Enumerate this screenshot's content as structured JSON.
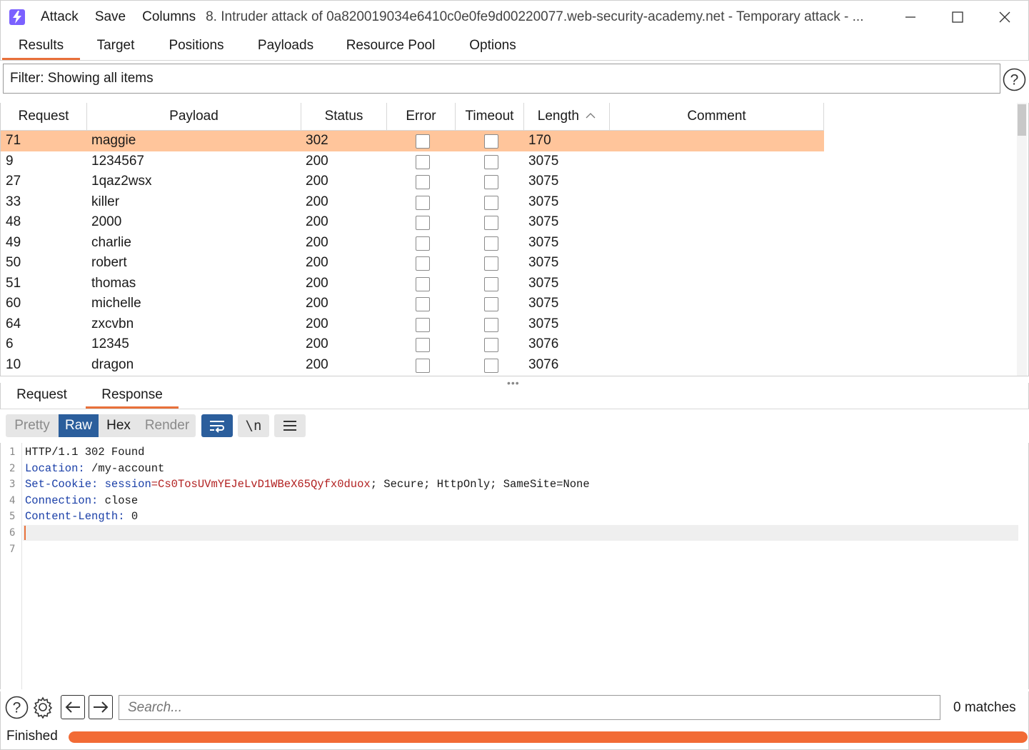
{
  "titlebar": {
    "menus": [
      "Attack",
      "Save",
      "Columns"
    ],
    "title": "8. Intruder attack of 0a820019034e6410c0e0fe9d00220077.web-security-academy.net - Temporary attack - ..."
  },
  "tabs": [
    {
      "label": "Results",
      "active": true
    },
    {
      "label": "Target",
      "active": false
    },
    {
      "label": "Positions",
      "active": false
    },
    {
      "label": "Payloads",
      "active": false
    },
    {
      "label": "Resource Pool",
      "active": false
    },
    {
      "label": "Options",
      "active": false
    }
  ],
  "filter": {
    "text": "Filter: Showing all items"
  },
  "table": {
    "columns": [
      "Request",
      "Payload",
      "Status",
      "Error",
      "Timeout",
      "Length",
      "Comment"
    ],
    "sort_indicator": "^",
    "rows": [
      {
        "request": "71",
        "payload": "maggie",
        "status": "302",
        "length": "170",
        "selected": true
      },
      {
        "request": "9",
        "payload": "1234567",
        "status": "200",
        "length": "3075"
      },
      {
        "request": "27",
        "payload": "1qaz2wsx",
        "status": "200",
        "length": "3075"
      },
      {
        "request": "33",
        "payload": "killer",
        "status": "200",
        "length": "3075"
      },
      {
        "request": "48",
        "payload": "2000",
        "status": "200",
        "length": "3075"
      },
      {
        "request": "49",
        "payload": "charlie",
        "status": "200",
        "length": "3075"
      },
      {
        "request": "50",
        "payload": "robert",
        "status": "200",
        "length": "3075"
      },
      {
        "request": "51",
        "payload": "thomas",
        "status": "200",
        "length": "3075"
      },
      {
        "request": "60",
        "payload": "michelle",
        "status": "200",
        "length": "3075"
      },
      {
        "request": "64",
        "payload": "zxcvbn",
        "status": "200",
        "length": "3075"
      },
      {
        "request": "6",
        "payload": "12345",
        "status": "200",
        "length": "3076"
      },
      {
        "request": "10",
        "payload": "dragon",
        "status": "200",
        "length": "3076"
      }
    ]
  },
  "lower_tabs": [
    {
      "label": "Request",
      "active": false
    },
    {
      "label": "Response",
      "active": true
    }
  ],
  "view_modes": [
    {
      "label": "Pretty",
      "active": false
    },
    {
      "label": "Raw",
      "active": true
    },
    {
      "label": "Hex",
      "active": false
    },
    {
      "label": "Render",
      "active": false
    }
  ],
  "newline_label": "\\n",
  "response": {
    "lines": [
      {
        "n": "1",
        "key": "HTTP/1.1 302 Found",
        "value": ""
      },
      {
        "n": "2",
        "key": "Location:",
        "value": " /my-account"
      },
      {
        "n": "3",
        "key": "Set-Cookie:",
        "cookie_name": " session",
        "cookie_value": "=Cs0TosUVmYEJeLvD1WBeX65Qyfx0duox",
        "rest": "; Secure; HttpOnly; SameSite=None"
      },
      {
        "n": "4",
        "key": "Connection:",
        "value": " close"
      },
      {
        "n": "5",
        "key": "Content-Length:",
        "value": " 0"
      },
      {
        "n": "6",
        "key": "",
        "value": ""
      },
      {
        "n": "7",
        "key": "",
        "value": ""
      }
    ]
  },
  "search": {
    "placeholder": "Search..."
  },
  "matches": "0 matches",
  "status": {
    "text": "Finished",
    "progress": 1.0
  },
  "colors": {
    "accent": "#e8703a",
    "selected_row": "#ffc59b",
    "active_mode": "#2b5e9c",
    "progress": "#f26b35"
  }
}
